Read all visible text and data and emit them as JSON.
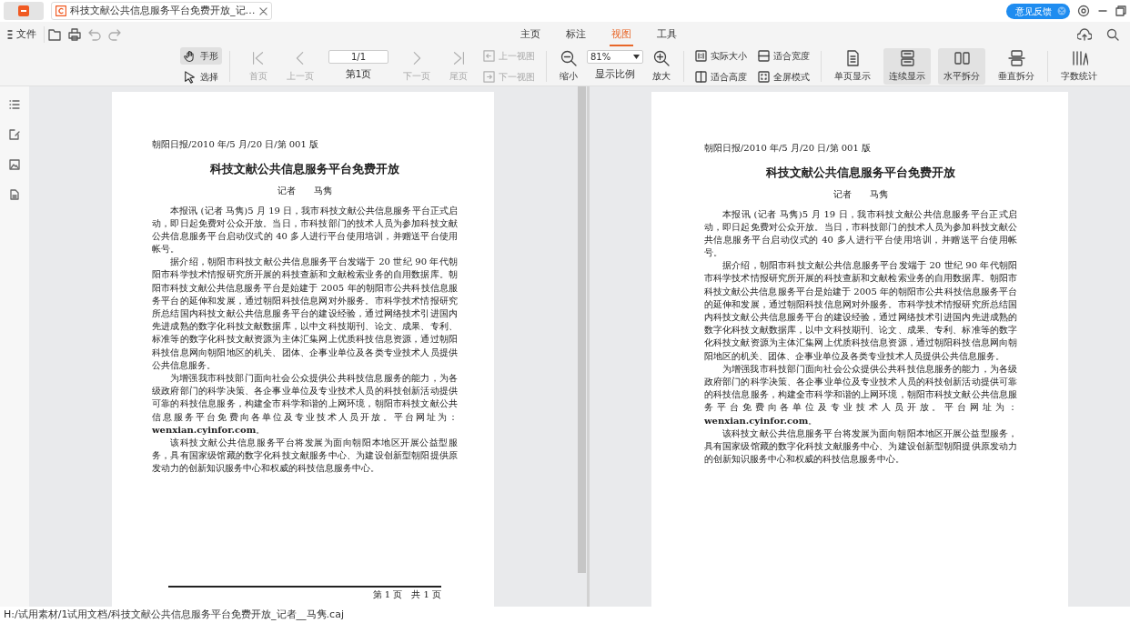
{
  "tabs": [
    {
      "label": "科技文献公共信息服务平台免费开放_记…",
      "selected": true
    }
  ],
  "title_bar": {
    "feedback": "意见反馈"
  },
  "menu": {
    "file": "文件",
    "tabs": [
      {
        "label": "主页",
        "selected": false
      },
      {
        "label": "标注",
        "selected": false
      },
      {
        "label": "视图",
        "selected": true
      },
      {
        "label": "工具",
        "selected": false
      }
    ]
  },
  "toolbar": {
    "pointer_tools": [
      {
        "label": "手形",
        "selected": true
      },
      {
        "label": "选择",
        "selected": false
      }
    ],
    "page_nav_prev": [
      {
        "label": "首页",
        "disabled": true
      },
      {
        "label": "上一页",
        "disabled": true
      }
    ],
    "page_field": {
      "value": "1/1",
      "label": "第1页"
    },
    "page_nav_next": [
      {
        "label": "下一页",
        "disabled": true
      },
      {
        "label": "尾页",
        "disabled": true
      }
    ],
    "view_nav": [
      {
        "label": "上一视图",
        "disabled": true
      },
      {
        "label": "下一视图",
        "disabled": true
      }
    ],
    "zoom_out": "缩小",
    "zoom": {
      "value": "81%",
      "label": "显示比例"
    },
    "zoom_in": "放大",
    "fit": [
      "实际大小",
      "适合高度",
      "适合宽度",
      "全屏模式"
    ],
    "layout": [
      {
        "label": "单页显示",
        "selected": false
      },
      {
        "label": "连续显示",
        "selected": true
      },
      {
        "label": "水平拆分",
        "selected": true
      },
      {
        "label": "垂直拆分",
        "selected": false
      }
    ],
    "word_count": "字数统计"
  },
  "panes": [
    {
      "source": "朝阳日报/2010 年/5 月/20 日/第 001 版",
      "title": "科技文献公共信息服务平台免费开放",
      "byline": "记者　　马隽",
      "paragraphs": [
        "本报讯 (记者 马隽)5 月 19 日，我市科技文献公共信息服务平台正式启动，即日起免费对公众开放。当日，市科技部门的技术人员为参加科技文献公共信息服务平台启动仪式的 40 多人进行平台使用培训，并赠送平台使用帐号。",
        "据介绍，朝阳市科技文献公共信息服务平台发端于 20 世纪 90 年代朝阳市科学技术情报研究所开展的科技查新和文献检索业务的自用数据库。朝阳市科技文献公共信息服务平台是始建于 2005 年的朝阳市公共科技信息服务平台的延伸和发展，通过朝阳科技信息网对外服务。市科学技术情报研究所总结国内科技文献公共信息服务平台的建设经验，通过网络技术引进国内先进成熟的数字化科技文献数据库，以中文科技期刊、论文、成果、专利、标准等的数字化科技文献资源为主体汇集网上优质科技信息资源，通过朝阳科技信息网向朝阳地区的机关、团体、企事业单位及各类专业技术人员提供公共信息服务。",
        "为增强我市科技部门面向社会公众提供公共科技信息服务的能力，为各级政府部门的科学决策、各企事业单位及专业技术人员的科技创新活动提供可靠的科技信息服务，构建全市科学和谐的上网环境，朝阳市科技文献公共信息服务平台免费向各单位及专业技术人员开放。平台网址为：**wenxian.cyinfor.com**。",
        "该科技文献公共信息服务平台将发展为面向朝阳本地区开展公益型服务，具有国家级馆藏的数字化科技文献服务中心、为建设创新型朝阳提供原发动力的创新知识服务中心和权威的科技信息服务中心。"
      ],
      "footer": "第 1 页　共 1 页"
    },
    {
      "source": "朝阳日报/2010 年/5 月/20 日/第 001 版",
      "title": "科技文献公共信息服务平台免费开放",
      "byline": "记者　　马隽",
      "paragraphs": [
        "本报讯 (记者 马隽)5 月 19 日，我市科技文献公共信息服务平台正式启动，即日起免费对公众开放。当日，市科技部门的技术人员为参加科技文献公共信息服务平台启动仪式的 40 多人进行平台使用培训，并赠送平台使用帐号。",
        "据介绍，朝阳市科技文献公共信息服务平台发端于 20 世纪 90 年代朝阳市科学技术情报研究所开展的科技查新和文献检索业务的自用数据库。朝阳市科技文献公共信息服务平台是始建于 2005 年的朝阳市公共科技信息服务平台的延伸和发展，通过朝阳科技信息网对外服务。市科学技术情报研究所总结国内科技文献公共信息服务平台的建设经验，通过网络技术引进国内先进成熟的数字化科技文献数据库，以中文科技期刊、论文、成果、专利、标准等的数字化科技文献资源为主体汇集网上优质科技信息资源，通过朝阳科技信息网向朝阳地区的机关、团体、企事业单位及各类专业技术人员提供公共信息服务。",
        "为增强我市科技部门面向社会公众提供公共科技信息服务的能力，为各级政府部门的科学决策、各企事业单位及专业技术人员的科技创新活动提供可靠的科技信息服务，构建全市科学和谐的上网环境，朝阳市科技文献公共信息服务平台免费向各单位及专业技术人员开放。平台网址为：**wenxian.cyinfor.com**。",
        "该科技文献公共信息服务平台将发展为面向朝阳本地区开展公益型服务，具有国家级馆藏的数字化科技文献服务中心、为建设创新型朝阳提供原发动力的创新知识服务中心和权威的科技信息服务中心。"
      ]
    }
  ],
  "status_bar": "H:/试用素材/1试用文档/科技文献公共信息服务平台免费开放_记者__马隽.caj"
}
